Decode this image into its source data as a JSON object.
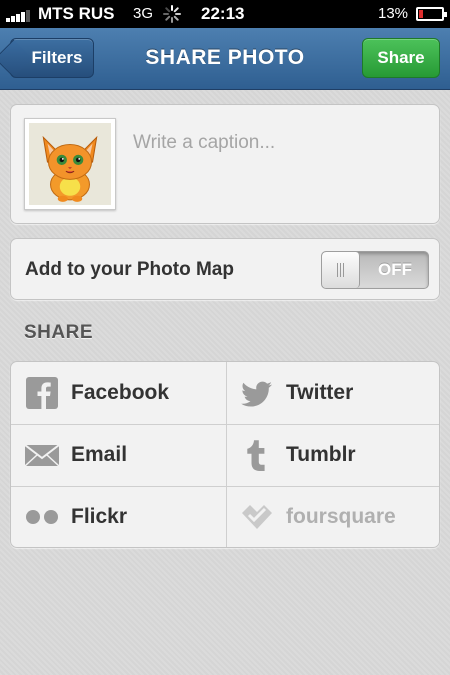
{
  "status_bar": {
    "carrier": "MTS RUS",
    "network": "3G",
    "time": "22:13",
    "battery": "13%"
  },
  "nav": {
    "back_label": "Filters",
    "title": "SHARE PHOTO",
    "share_label": "Share"
  },
  "caption": {
    "placeholder": "Write a caption..."
  },
  "photo_map": {
    "label": "Add to your Photo Map",
    "toggle_state": "OFF"
  },
  "share_section": {
    "header": "SHARE",
    "services": [
      {
        "label": "Facebook",
        "icon": "facebook-icon"
      },
      {
        "label": "Twitter",
        "icon": "twitter-icon"
      },
      {
        "label": "Email",
        "icon": "email-icon"
      },
      {
        "label": "Tumblr",
        "icon": "tumblr-icon"
      },
      {
        "label": "Flickr",
        "icon": "flickr-icon"
      },
      {
        "label": "foursquare",
        "icon": "foursquare-icon"
      }
    ]
  },
  "colors": {
    "nav_blue": "#3a6c9f",
    "share_green": "#2faa3e",
    "battery_low": "#e03030"
  }
}
